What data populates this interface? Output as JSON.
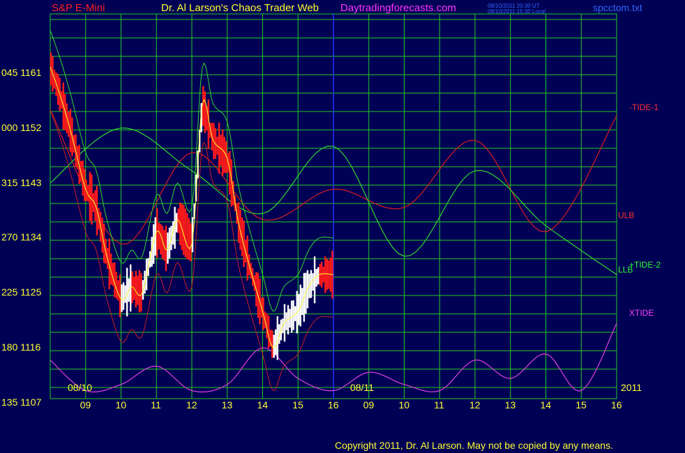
{
  "header": {
    "symbol": "S&P E-Mini",
    "title": "Dr. Al Larson's Chaos Trader Web",
    "site": "Daytradingforecasts.com",
    "timestamp_ut": "08/10/2011 20:30 UT",
    "timestamp_local": "08/10/2011 15:30 Local",
    "file": "spcctom.txt"
  },
  "footer": {
    "copyright": "Copyright 2011, Dr. Al Larson. May not be copied by any means."
  },
  "colors": {
    "background": "#000055",
    "grid": "#22cc22",
    "price_down": "#ff1a1a",
    "price_up": "#ffffff",
    "tide1": "#d81e1e",
    "tide2": "#30d830",
    "xtide": "#e040e0",
    "band": "#c82020",
    "blue": "#2233ff",
    "yellow": "#ffff33"
  },
  "chart_data": {
    "type": "line",
    "y_axis": {
      "ticks": [
        {
          "left": "045",
          "value": 1161
        },
        {
          "left": "000",
          "value": 1152
        },
        {
          "left": "315",
          "value": 1143
        },
        {
          "left": "270",
          "value": 1134
        },
        {
          "left": "225",
          "value": 1125
        },
        {
          "left": "180",
          "value": 1116
        },
        {
          "left": "135",
          "value": 1107
        }
      ],
      "ylim": [
        1107,
        1170
      ]
    },
    "x_axis": {
      "tick_labels": [
        "09",
        "10",
        "11",
        "12",
        "13",
        "14",
        "15",
        "16",
        "09",
        "10",
        "11",
        "12",
        "13",
        "14",
        "15",
        "16"
      ],
      "date_labels": [
        "08/10",
        "08/11"
      ],
      "year": "2011"
    },
    "series": [
      {
        "name": "-TIDE-1",
        "color": "#d81e1e",
        "x": [
          0,
          2,
          4,
          6,
          8,
          10,
          12,
          14,
          16
        ],
        "y": [
          1155,
          1133,
          1148,
          1137,
          1142,
          1139,
          1150,
          1135,
          1154
        ]
      },
      {
        "name": "+TIDE-2",
        "color": "#30d830",
        "x": [
          0,
          2,
          4,
          6,
          8,
          10,
          12,
          14,
          16
        ],
        "y": [
          1143,
          1152,
          1145,
          1138,
          1149,
          1131,
          1145,
          1136,
          1128
        ]
      },
      {
        "name": "XTIDE",
        "color": "#e040e0",
        "x": [
          0,
          1,
          2,
          3,
          4,
          5,
          6,
          7,
          8,
          9,
          10,
          11,
          12,
          13,
          14,
          15,
          16
        ],
        "y": [
          1114,
          1109,
          1110,
          1113,
          1109,
          1110,
          1116,
          1111,
          1109,
          1112,
          1110,
          1109,
          1114,
          1111,
          1115,
          1109,
          1120
        ]
      }
    ],
    "band_labels": [
      "ULB",
      "LLB"
    ],
    "price_path": {
      "x": [
        0,
        0.3,
        0.6,
        1,
        1.3,
        1.6,
        2,
        2.3,
        2.6,
        3,
        3.3,
        3.6,
        4,
        4.3,
        4.6,
        5,
        5.3,
        5.6,
        6,
        6.3,
        6.6,
        7,
        7.3,
        7.6,
        8
      ],
      "y": [
        1162,
        1157,
        1151,
        1142,
        1139,
        1131,
        1124,
        1126,
        1125,
        1135,
        1132,
        1137,
        1133,
        1156,
        1150,
        1147,
        1137,
        1130,
        1122,
        1116,
        1120,
        1122,
        1126,
        1128,
        1128
      ]
    }
  },
  "right_labels": {
    "tide1": "-TIDE-1",
    "ulb": "ULB",
    "tide2": "+TIDE-2",
    "llb": "LLB",
    "xtide": "XTIDE"
  }
}
